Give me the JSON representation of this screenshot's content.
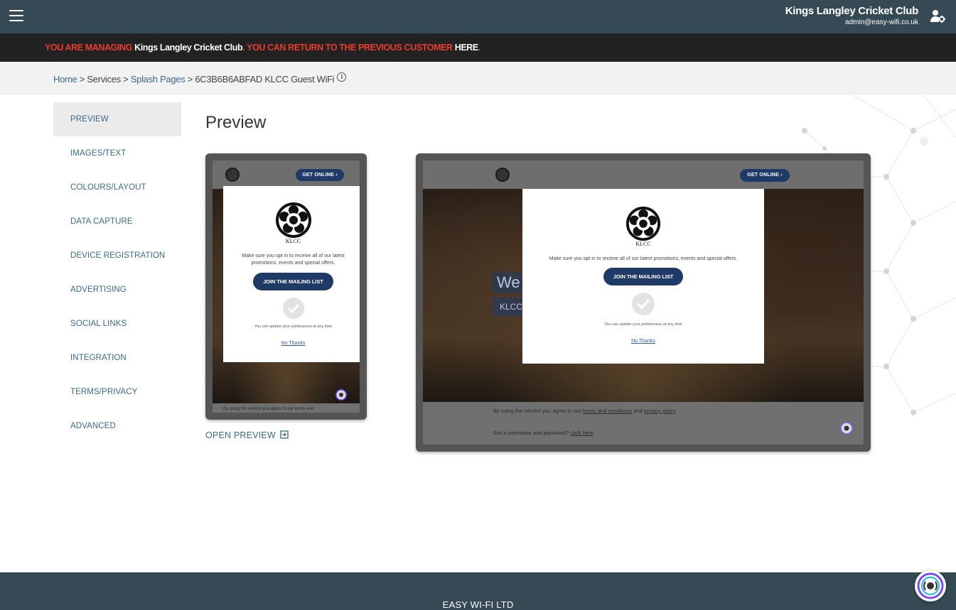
{
  "header": {
    "club_name": "Kings Langley Cricket Club",
    "email": "admin@easy-wifi.co.uk"
  },
  "manage_banner": {
    "part1": "YOU ARE MANAGING ",
    "customer": "Kings Langley Cricket Club",
    "part2": ". YOU CAN RETURN TO THE PREVIOUS CUSTOMER ",
    "here": "HERE",
    "end": "."
  },
  "breadcrumb": {
    "home": "Home",
    "sep": " > ",
    "services": "Services",
    "splash_pages": "Splash Pages",
    "current": "6C3B6B6ABFAD KLCC Guest WiFi"
  },
  "sidebar": {
    "items": [
      {
        "label": "PREVIEW"
      },
      {
        "label": "IMAGES/TEXT"
      },
      {
        "label": "COLOURS/LAYOUT"
      },
      {
        "label": "DATA CAPTURE"
      },
      {
        "label": "DEVICE REGISTRATION"
      },
      {
        "label": "ADVERTISING"
      },
      {
        "label": "SOCIAL LINKS"
      },
      {
        "label": "INTEGRATION"
      },
      {
        "label": "TERMS/PRIVACY"
      },
      {
        "label": "ADVANCED"
      }
    ]
  },
  "main": {
    "title": "Preview",
    "open_preview": "OPEN PREVIEW"
  },
  "splash": {
    "get_online": "GET ONLINE",
    "logo_text": "KLCC",
    "mobile_message": "Make sure you opt in to receive all of our latest promotions, events and special offers.",
    "desktop_message": "Make sure you opt in to receive all of our latest promotions, events and special offers.",
    "join_button": "JOIN THE MAILING LIST",
    "preferences_note": "You can update your preferences at any time",
    "no_thanks": "No Thanks",
    "welcome_partial": "We",
    "klcc_partial": "KLCC",
    "terms_prefix": "By using the service you agree to our ",
    "terms_link": "terms and conditions",
    "terms_and": " and ",
    "privacy_link": "privacy policy",
    "mobile_terms_partial": "By using the service you agree to our terms and",
    "login_prefix": "Got a username and password? ",
    "login_link": "click here"
  },
  "footer": {
    "company": "EASY WI-FI LTD"
  },
  "colors": {
    "header_bg": "#354a54",
    "banner_bg": "#222222",
    "banner_red": "#ea3c2e",
    "link_blue": "#3a6a85",
    "button_navy": "#1f3a66"
  }
}
